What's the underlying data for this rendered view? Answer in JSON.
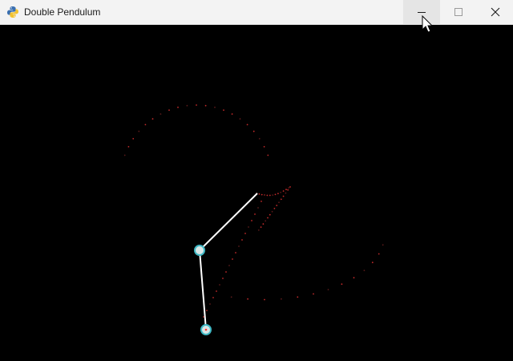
{
  "window": {
    "title": "Double Pendulum",
    "icon": "python-icon"
  },
  "controls": {
    "minimize_icon": "minimize-icon",
    "maximize_icon": "maximize-icon",
    "close_icon": "close-icon"
  },
  "colors": {
    "background": "#000000",
    "rod": "#ffffff",
    "bob_fill": "#d9e6e6",
    "bob_ring": "#3fb8c4",
    "trail": "#ff2a2a"
  }
}
